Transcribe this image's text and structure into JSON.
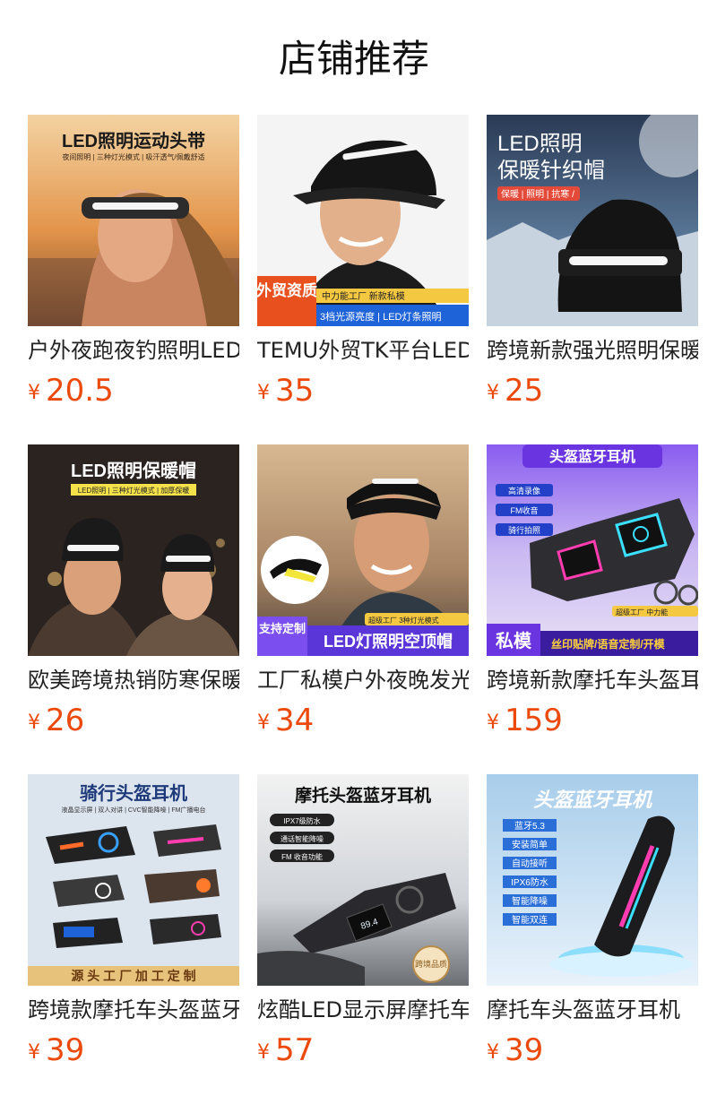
{
  "section_title": "店铺推荐",
  "currency": "¥",
  "products": [
    {
      "title": "户外夜跑夜钓照明LED",
      "price": "20.5",
      "image": {
        "headline": "LED照明运动头带",
        "subline": "夜间照明 | 三种灯光模式 | 吸汗透气/佩戴舒适"
      }
    },
    {
      "title": "TEMU外贸TK平台LED",
      "price": "35",
      "image": {
        "badge": "外贸资质",
        "tag": "中力能工厂 新款私模",
        "caption": "3档光源亮度 | LED灯条照明"
      }
    },
    {
      "title": "跨境新款强光照明保暖",
      "price": "25",
      "image": {
        "headline_1": "LED照明",
        "headline_2": "保暖针织帽",
        "tag": "保暖 | 照明 | 抗寒 /"
      }
    },
    {
      "title": "欧美跨境热销防寒保暖",
      "price": "26",
      "image": {
        "headline": "LED照明保暖帽",
        "subline": "LED照明 | 三种灯光模式 | 加厚保暖"
      }
    },
    {
      "title": "工厂私模户外夜晚发光",
      "price": "34",
      "image": {
        "badge": "支持定制",
        "tag": "超级工厂 3种灯光模式",
        "caption": "LED灯照明空顶帽"
      }
    },
    {
      "title": "跨境新款摩托车头盔耳机",
      "price": "159",
      "image": {
        "headline": "头盔蓝牙耳机",
        "features": [
          "高清录像",
          "FM收音",
          "骑行拍照"
        ],
        "tag": "超级工厂 中力能",
        "badge": "私模",
        "caption": "丝印贴牌/语音定制/开模"
      }
    },
    {
      "title": "跨境款摩托车头盔蓝牙耳机",
      "price": "39",
      "image": {
        "headline": "骑行头盔耳机",
        "subline": "液晶显示屏 | 双人对讲 | CVC智能降噪 | FM广播电台",
        "caption": "源 头 工 厂   加 工 定 制"
      }
    },
    {
      "title": "炫酷LED显示屏摩托车头盔",
      "price": "57",
      "image": {
        "headline": "摩托头盔蓝牙耳机",
        "features": [
          "IPX7级防水",
          "通话智能降噪",
          "FM 收音功能"
        ],
        "badge": "跨境品质",
        "screen": "89.4"
      }
    },
    {
      "title": "摩托车头盔蓝牙耳机",
      "price": "39",
      "image": {
        "headline": "头盔蓝牙耳机",
        "features": [
          "蓝牙5.3",
          "安装简单",
          "自动接听",
          "IPX6防水",
          "智能降噪",
          "智能双连"
        ]
      }
    }
  ]
}
